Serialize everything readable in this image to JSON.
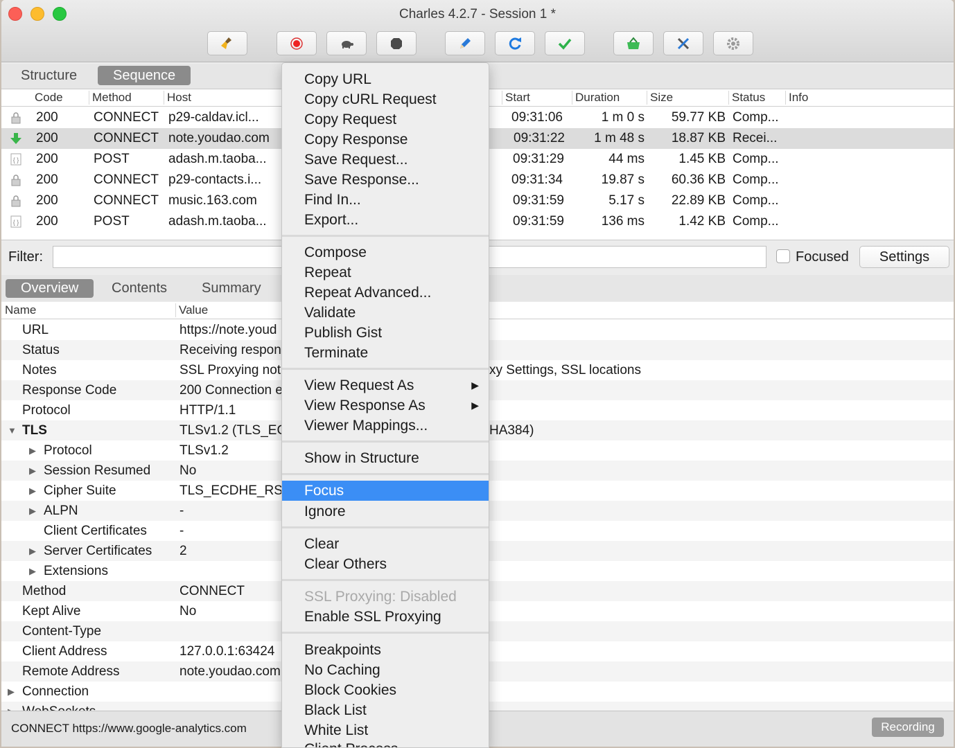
{
  "window": {
    "title": "Charles 4.2.7 - Session 1 *"
  },
  "toolbar": {
    "buttons": [
      "broom-icon",
      "record-icon",
      "turtle-icon",
      "stop-icon",
      "pen-icon",
      "refresh-icon",
      "check-icon",
      "basket-icon",
      "tools-icon",
      "gear-icon"
    ]
  },
  "view_tabs": {
    "structure": "Structure",
    "sequence": "Sequence"
  },
  "table": {
    "headers": {
      "code": "Code",
      "method": "Method",
      "host": "Host",
      "start": "Start",
      "duration": "Duration",
      "size": "Size",
      "status": "Status",
      "info": "Info"
    },
    "rows": [
      {
        "icon": "lock-icon",
        "code": "200",
        "method": "CONNECT",
        "host": "p29-caldav.icl...",
        "path": "",
        "start": "09:31:06",
        "duration": "1 m 0 s",
        "size": "59.77 KB",
        "status": "Comp..."
      },
      {
        "icon": "download-arrow-icon",
        "code": "200",
        "method": "CONNECT",
        "host": "note.youdao.com",
        "path": "",
        "start": "09:31:22",
        "duration": "1 m 48 s",
        "size": "18.87 KB",
        "status": "Recei..."
      },
      {
        "icon": "json-icon",
        "code": "200",
        "method": "POST",
        "host": "adash.m.taoba...",
        "path": "/",
        "start": "09:31:29",
        "duration": "44 ms",
        "size": "1.45 KB",
        "status": "Comp..."
      },
      {
        "icon": "lock-icon",
        "code": "200",
        "method": "CONNECT",
        "host": "p29-contacts.i...",
        "path": "",
        "start": "09:31:34",
        "duration": "19.87 s",
        "size": "60.36 KB",
        "status": "Comp..."
      },
      {
        "icon": "lock-icon",
        "code": "200",
        "method": "CONNECT",
        "host": "music.163.com",
        "path": "",
        "start": "09:31:59",
        "duration": "5.17 s",
        "size": "22.89 KB",
        "status": "Comp..."
      },
      {
        "icon": "json-icon",
        "code": "200",
        "method": "POST",
        "host": "adash.m.taoba...",
        "path": "/",
        "start": "09:31:59",
        "duration": "136 ms",
        "size": "1.42 KB",
        "status": "Comp..."
      }
    ]
  },
  "filter": {
    "label": "Filter:",
    "value": "",
    "focused_label": "Focused",
    "settings_label": "Settings"
  },
  "detail_tabs": {
    "overview": "Overview",
    "contents": "Contents",
    "summary": "Summary"
  },
  "detail": {
    "headers": {
      "name": "Name",
      "value": "Value"
    },
    "rows": [
      {
        "name": "URL",
        "value": "https://note.youd"
      },
      {
        "name": "Status",
        "value": "Receiving respon"
      },
      {
        "name": "Notes",
        "value": "SSL Proxying not",
        "value_right": "xy Settings, SSL locations"
      },
      {
        "name": "Response Code",
        "value": "200 Connection e"
      },
      {
        "name": "Protocol",
        "value": "HTTP/1.1"
      },
      {
        "name": "TLS",
        "value": "TLSv1.2 (TLS_EC",
        "value_right": "HA384)"
      },
      {
        "name": "Protocol",
        "value": "TLSv1.2"
      },
      {
        "name": "Session Resumed",
        "value": "No"
      },
      {
        "name": "Cipher Suite",
        "value": "TLS_ECDHE_RSA"
      },
      {
        "name": "ALPN",
        "value": "-"
      },
      {
        "name": "Client Certificates",
        "value": "-"
      },
      {
        "name": "Server Certificates",
        "value": "2"
      },
      {
        "name": "Extensions",
        "value": ""
      },
      {
        "name": "Method",
        "value": "CONNECT"
      },
      {
        "name": "Kept Alive",
        "value": "No"
      },
      {
        "name": "Content-Type",
        "value": ""
      },
      {
        "name": "Client Address",
        "value": "127.0.0.1:63424"
      },
      {
        "name": "Remote Address",
        "value": "note.youdao.com"
      },
      {
        "name": "Connection",
        "value": ""
      },
      {
        "name": "WebSockets",
        "value": ""
      }
    ]
  },
  "statusbar": {
    "text": "CONNECT https://www.google-analytics.com",
    "recording": "Recording"
  },
  "context_menu": {
    "items": [
      "Copy URL",
      "Copy cURL Request",
      "Copy Request",
      "Copy Response",
      "Save Request...",
      "Save Response...",
      "Find In...",
      "Export...",
      "Compose",
      "Repeat",
      "Repeat Advanced...",
      "Validate",
      "Publish Gist",
      "Terminate",
      "View Request As",
      "View Response As",
      "Viewer Mappings...",
      "Show in Structure",
      "Focus",
      "Ignore",
      "Clear",
      "Clear Others",
      "SSL Proxying: Disabled",
      "Enable SSL Proxying",
      "Breakpoints",
      "No Caching",
      "Block Cookies",
      "Black List",
      "White List",
      "Client Process"
    ],
    "highlighted": "Focus",
    "disabled": "SSL Proxying: Disabled"
  },
  "colors": {
    "highlight": "#3b8ef5",
    "selected_row": "#dcdcdc"
  }
}
